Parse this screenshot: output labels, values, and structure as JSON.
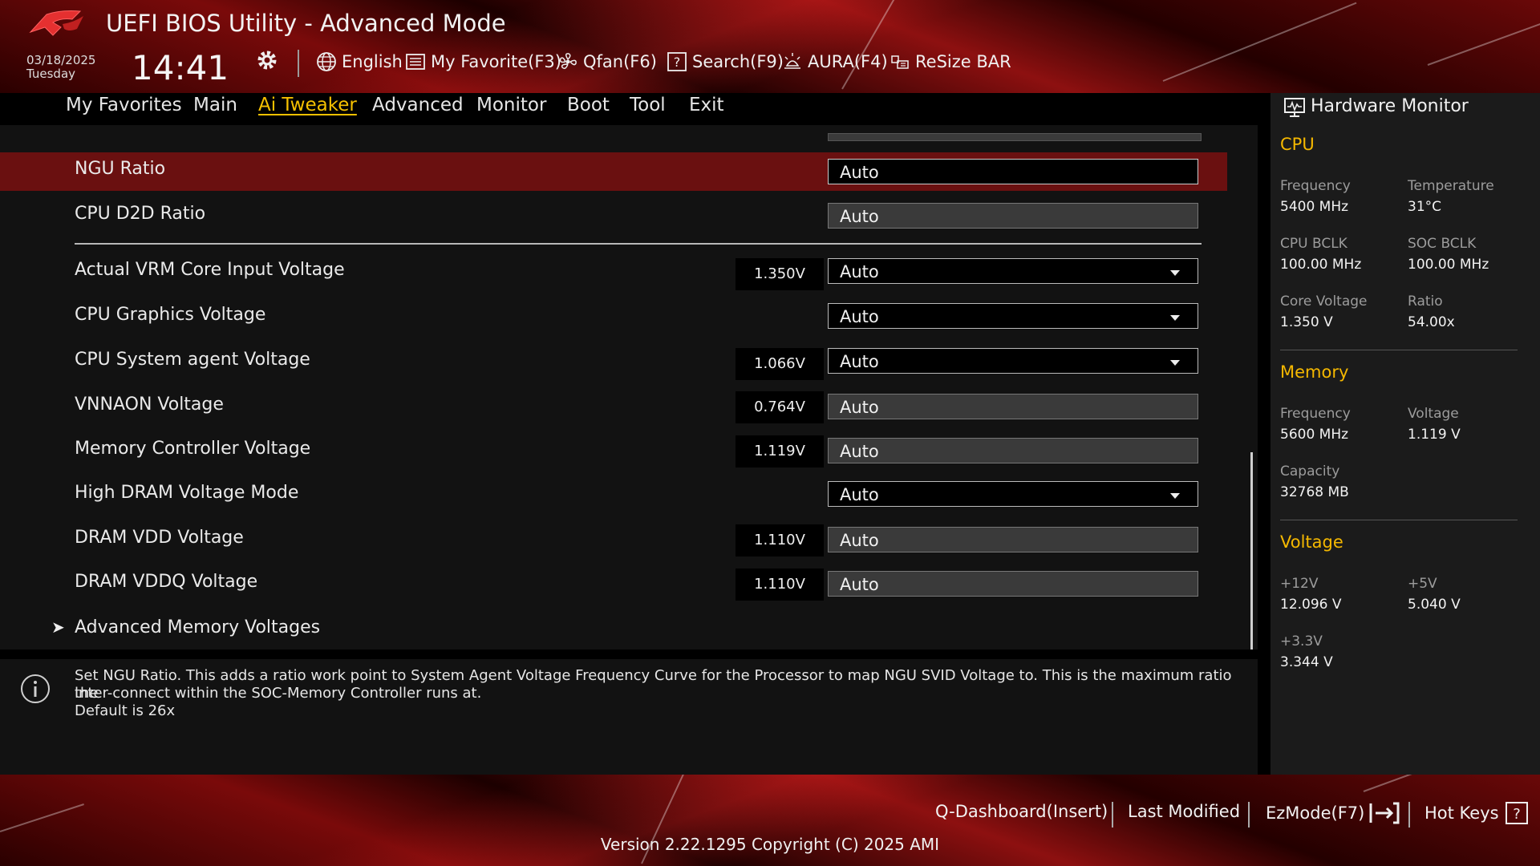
{
  "header": {
    "title": "UEFI BIOS Utility - Advanced Mode",
    "date": "03/18/2025",
    "day": "Tuesday",
    "time": "14:41",
    "toolbar": [
      {
        "label": "English",
        "icon": "globe-icon"
      },
      {
        "label": "My Favorite(F3)",
        "icon": "favorite-list-icon"
      },
      {
        "label": "Qfan(F6)",
        "icon": "fan-icon"
      },
      {
        "label": "Search(F9)",
        "icon": "search-question-icon"
      },
      {
        "label": "AURA(F4)",
        "icon": "aura-light-icon"
      },
      {
        "label": "ReSize BAR",
        "icon": "resize-bar-icon"
      }
    ]
  },
  "nav": {
    "tabs": [
      "My Favorites",
      "Main",
      "Ai Tweaker",
      "Advanced",
      "Monitor",
      "Boot",
      "Tool",
      "Exit"
    ],
    "active": "Ai Tweaker"
  },
  "settings": [
    {
      "label": "NGU Ratio",
      "value": "Auto",
      "current": "",
      "dropdown": false,
      "selected": true
    },
    {
      "label": "CPU D2D Ratio",
      "value": "Auto",
      "current": "",
      "dropdown": false
    },
    {
      "label": "Actual VRM Core Input Voltage",
      "value": "Auto",
      "current": "1.350V",
      "dropdown": true
    },
    {
      "label": "CPU Graphics Voltage",
      "value": "Auto",
      "current": "",
      "dropdown": true
    },
    {
      "label": "CPU System agent Voltage",
      "value": "Auto",
      "current": "1.066V",
      "dropdown": true
    },
    {
      "label": "VNNAON Voltage",
      "value": "Auto",
      "current": "0.764V",
      "dropdown": false
    },
    {
      "label": "Memory Controller Voltage",
      "value": "Auto",
      "current": "1.119V",
      "dropdown": false
    },
    {
      "label": "High DRAM Voltage Mode",
      "value": "Auto",
      "current": "",
      "dropdown": true
    },
    {
      "label": "DRAM VDD Voltage",
      "value": "Auto",
      "current": "1.110V",
      "dropdown": false
    },
    {
      "label": "DRAM VDDQ Voltage",
      "value": "Auto",
      "current": "1.110V",
      "dropdown": false
    }
  ],
  "submenu": {
    "label": "Advanced Memory Voltages",
    "arrow": "➤"
  },
  "help": {
    "line1": "Set NGU Ratio. This adds a ratio work point to System Agent Voltage Frequency Curve for the Processor to map NGU SVID Voltage to. This is the maximum ratio the",
    "line2": "inter-connect within the SOC-Memory Controller runs at.",
    "line3": "Default is 26x"
  },
  "hardware_monitor": {
    "title": "Hardware Monitor",
    "cpu": {
      "heading": "CPU",
      "frequency_label": "Frequency",
      "frequency": "5400 MHz",
      "temperature_label": "Temperature",
      "temperature": "31°C",
      "cpu_bclk_label": "CPU BCLK",
      "cpu_bclk": "100.00 MHz",
      "soc_bclk_label": "SOC BCLK",
      "soc_bclk": "100.00 MHz",
      "core_voltage_label": "Core Voltage",
      "core_voltage": "1.350 V",
      "ratio_label": "Ratio",
      "ratio": "54.00x"
    },
    "memory": {
      "heading": "Memory",
      "frequency_label": "Frequency",
      "frequency": "5600 MHz",
      "voltage_label": "Voltage",
      "voltage": "1.119 V",
      "capacity_label": "Capacity",
      "capacity": "32768 MB"
    },
    "voltage": {
      "heading": "Voltage",
      "v12_label": "+12V",
      "v12": "12.096 V",
      "v5_label": "+5V",
      "v5": "5.040 V",
      "v33_label": "+3.3V",
      "v33": "3.344 V"
    }
  },
  "bottom": {
    "qdashboard": "Q-Dashboard(Insert)",
    "last_modified": "Last Modified",
    "ezmode": "EzMode(F7)",
    "hotkeys": "Hot Keys",
    "version": "Version 2.22.1295 Copyright (C) 2025 AMI"
  },
  "colors": {
    "accent": "#f5b800",
    "selected_row": "#6a1010",
    "brand_red": "#8d1010"
  }
}
